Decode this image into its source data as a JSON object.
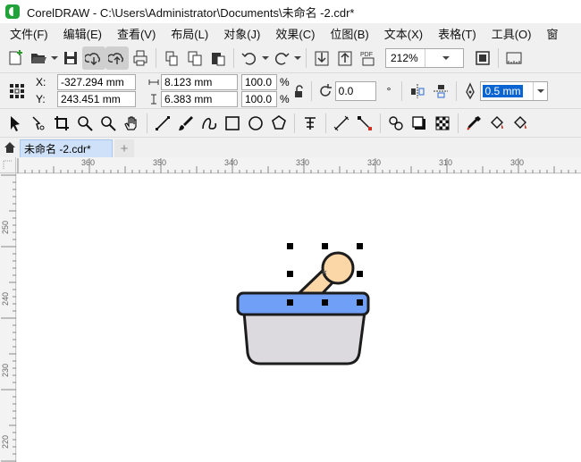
{
  "window": {
    "title": "CorelDRAW - C:\\Users\\Administrator\\Documents\\未命名 -2.cdr*"
  },
  "menu": [
    "文件(F)",
    "编辑(E)",
    "查看(V)",
    "布局(L)",
    "对象(J)",
    "效果(C)",
    "位图(B)",
    "文本(X)",
    "表格(T)",
    "工具(O)",
    "窗"
  ],
  "toolbar": {
    "zoom_value": "212%",
    "pdf_label": "PDF"
  },
  "property_bar": {
    "x_label": "X:",
    "x_value": "-327.294 mm",
    "y_label": "Y:",
    "y_value": "243.451 mm",
    "width_value": "8.123 mm",
    "height_value": "6.383 mm",
    "scale_x": "100.0",
    "scale_y": "100.0",
    "percent": "%",
    "rotation_value": "0.0",
    "degree_symbol": "°",
    "outline_width": "0.5 mm"
  },
  "tabs": {
    "document_tab": "未命名 -2.cdr*",
    "add_tab": "+"
  },
  "rulers": {
    "horizontal": [
      "360",
      "350",
      "340",
      "330",
      "320",
      "310",
      "300"
    ],
    "vertical": [
      "250",
      "240",
      "230",
      "220"
    ]
  },
  "colors": {
    "bowl_body": "#dcdadf",
    "bowl_rim": "#6f9ff6",
    "pestle": "#fbd6a6",
    "outline": "#1c1c1c",
    "tab_active": "#cfe1f8",
    "selection": "#3264c8"
  }
}
